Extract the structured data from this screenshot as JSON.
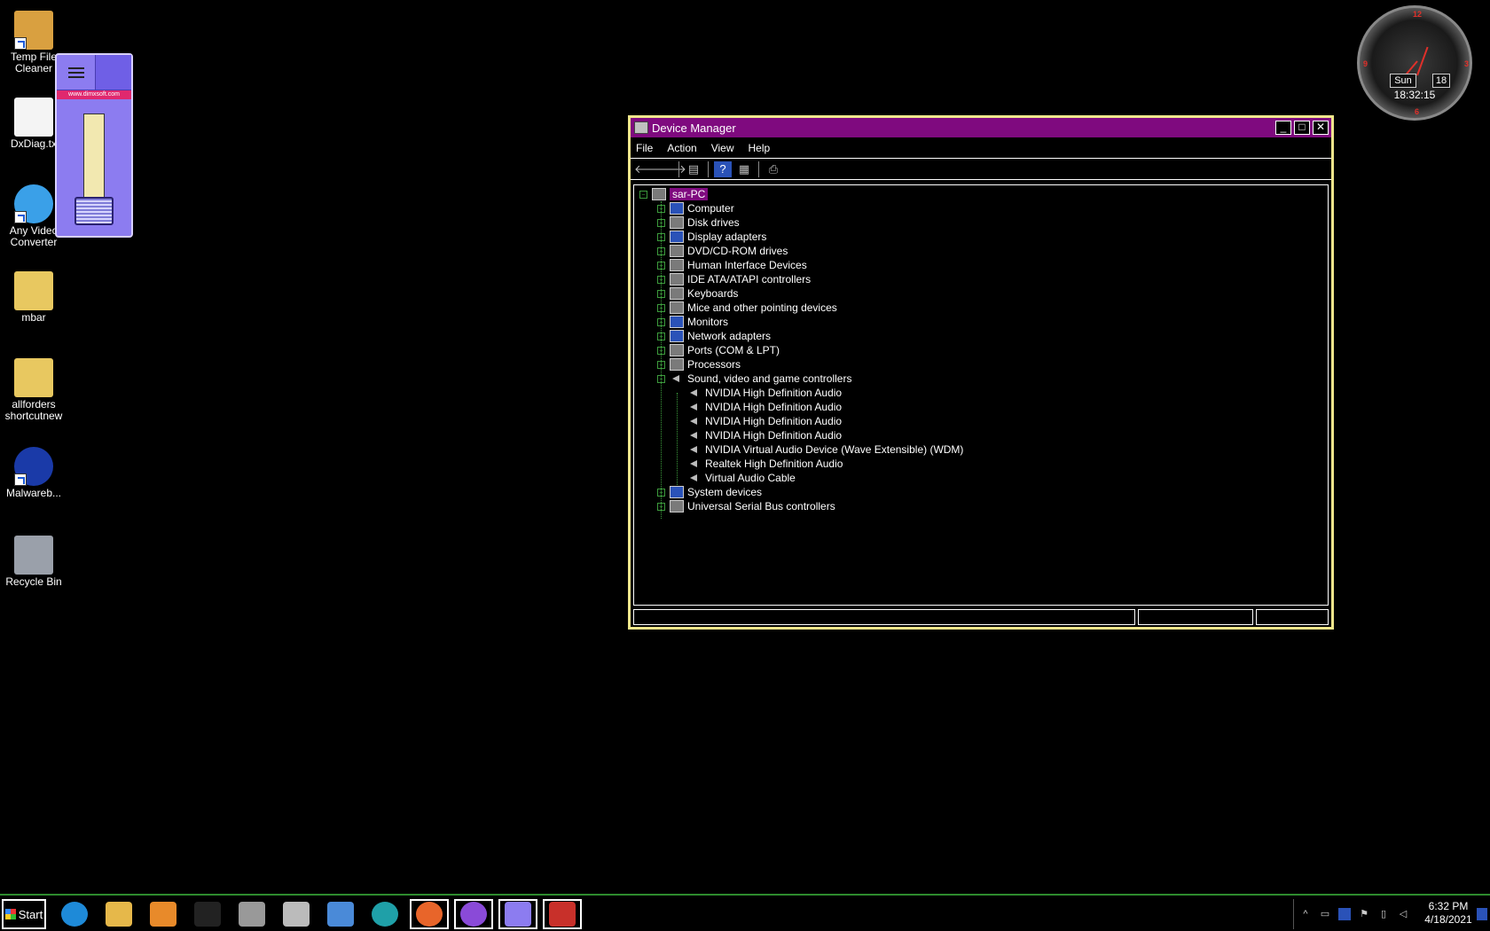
{
  "desktop": {
    "icons": [
      {
        "label": "Temp File\nCleaner",
        "icon": "temp-file-cleaner-icon"
      },
      {
        "label": "DxDiag.tx",
        "icon": "text-file-icon"
      },
      {
        "label": "Any Video\nConverter",
        "icon": "video-converter-icon"
      },
      {
        "label": "mbar",
        "icon": "folder-icon"
      },
      {
        "label": "allforders\nshortcutnew",
        "icon": "folder-icon"
      },
      {
        "label": "Malwareb...",
        "icon": "malwarebytes-icon"
      },
      {
        "label": "Recycle Bin",
        "icon": "recycle-bin-icon"
      }
    ]
  },
  "volume_widget": {
    "url": "www.dimxsoft.com"
  },
  "clock_gadget": {
    "day": "Sun",
    "date": "18",
    "time": "18:32:15",
    "n12": "12",
    "n3": "3",
    "n6": "6",
    "n9": "9"
  },
  "window": {
    "title": "Device Manager",
    "controls": {
      "minimize": "_",
      "maximize": "□",
      "close": "✕"
    },
    "menu": [
      "File",
      "Action",
      "View",
      "Help"
    ],
    "toolbar": {
      "back": "🡐",
      "forward": "🡒",
      "properties": "▤",
      "help": "?",
      "scan": "▦",
      "update": "⎙"
    },
    "tree": {
      "root": "sar-PC",
      "categories": [
        {
          "label": "Computer",
          "icon": "computer-icon"
        },
        {
          "label": "Disk drives",
          "icon": "disk-drive-icon"
        },
        {
          "label": "Display adapters",
          "icon": "display-adapter-icon"
        },
        {
          "label": "DVD/CD-ROM drives",
          "icon": "dvd-drive-icon"
        },
        {
          "label": "Human Interface Devices",
          "icon": "hid-icon"
        },
        {
          "label": "IDE ATA/ATAPI controllers",
          "icon": "ide-controller-icon"
        },
        {
          "label": "Keyboards",
          "icon": "keyboard-icon"
        },
        {
          "label": "Mice and other pointing devices",
          "icon": "mouse-icon"
        },
        {
          "label": "Monitors",
          "icon": "monitor-icon"
        },
        {
          "label": "Network adapters",
          "icon": "network-adapter-icon"
        },
        {
          "label": "Ports (COM & LPT)",
          "icon": "port-icon"
        },
        {
          "label": "Processors",
          "icon": "processor-icon"
        },
        {
          "label": "Sound, video and game controllers",
          "icon": "speaker-icon"
        }
      ],
      "sound_children": [
        "NVIDIA High Definition Audio",
        "NVIDIA High Definition Audio",
        "NVIDIA High Definition Audio",
        "NVIDIA High Definition Audio",
        "NVIDIA Virtual Audio Device (Wave Extensible) (WDM)",
        "Realtek High Definition Audio",
        "Virtual Audio Cable"
      ],
      "after": [
        {
          "label": "System devices",
          "icon": "system-devices-icon"
        },
        {
          "label": "Universal Serial Bus controllers",
          "icon": "usb-icon"
        }
      ]
    }
  },
  "taskbar": {
    "start_label": "Start",
    "apps": [
      {
        "name": "internet-explorer-icon",
        "color": "#1e8ad8"
      },
      {
        "name": "file-explorer-icon",
        "color": "#e6b84a"
      },
      {
        "name": "media-player-icon",
        "color": "#e88a2a"
      },
      {
        "name": "command-prompt-icon",
        "color": "#222222"
      },
      {
        "name": "mouse-settings-icon",
        "color": "#999999"
      },
      {
        "name": "on-screen-keyboard-icon",
        "color": "#bbbbbb"
      },
      {
        "name": "control-panel-icon",
        "color": "#4a8ad8"
      },
      {
        "name": "edge-icon",
        "color": "#1fa0a8"
      },
      {
        "name": "firefox-icon",
        "color": "#e8652a"
      },
      {
        "name": "browser-icon",
        "color": "#8a4ad8"
      },
      {
        "name": "volume-widget-icon",
        "color": "#8c7cf0"
      },
      {
        "name": "toolbox-icon",
        "color": "#c8302a"
      }
    ],
    "tray": {
      "time": "6:32 PM",
      "date": "4/18/2021"
    }
  }
}
